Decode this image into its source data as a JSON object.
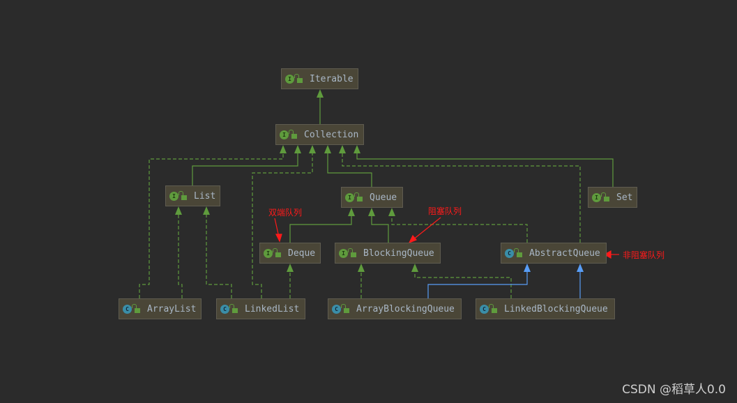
{
  "nodes": {
    "iterable": {
      "label": "Iterable",
      "kind": "I"
    },
    "collection": {
      "label": "Collection",
      "kind": "I"
    },
    "list": {
      "label": "List",
      "kind": "I"
    },
    "queue": {
      "label": "Queue",
      "kind": "I"
    },
    "set": {
      "label": "Set",
      "kind": "I"
    },
    "deque": {
      "label": "Deque",
      "kind": "I"
    },
    "blocking_queue": {
      "label": "BlockingQueue",
      "kind": "I"
    },
    "abstract_queue": {
      "label": "AbstractQueue",
      "kind": "C"
    },
    "array_list": {
      "label": "ArrayList",
      "kind": "C"
    },
    "linked_list": {
      "label": "LinkedList",
      "kind": "C"
    },
    "array_blocking_queue": {
      "label": "ArrayBlockingQueue",
      "kind": "C"
    },
    "linked_blocking_queue": {
      "label": "LinkedBlockingQueue",
      "kind": "C"
    }
  },
  "annotations": {
    "deque_note": "双端队列",
    "blocking_note": "阻塞队列",
    "nonblocking_note": "非阻塞队列"
  },
  "colors": {
    "extends": "#5f9b3d",
    "class_extends": "#589df6",
    "annotation": "#ff1a1a"
  },
  "watermark": "CSDN @稻草人0.0"
}
